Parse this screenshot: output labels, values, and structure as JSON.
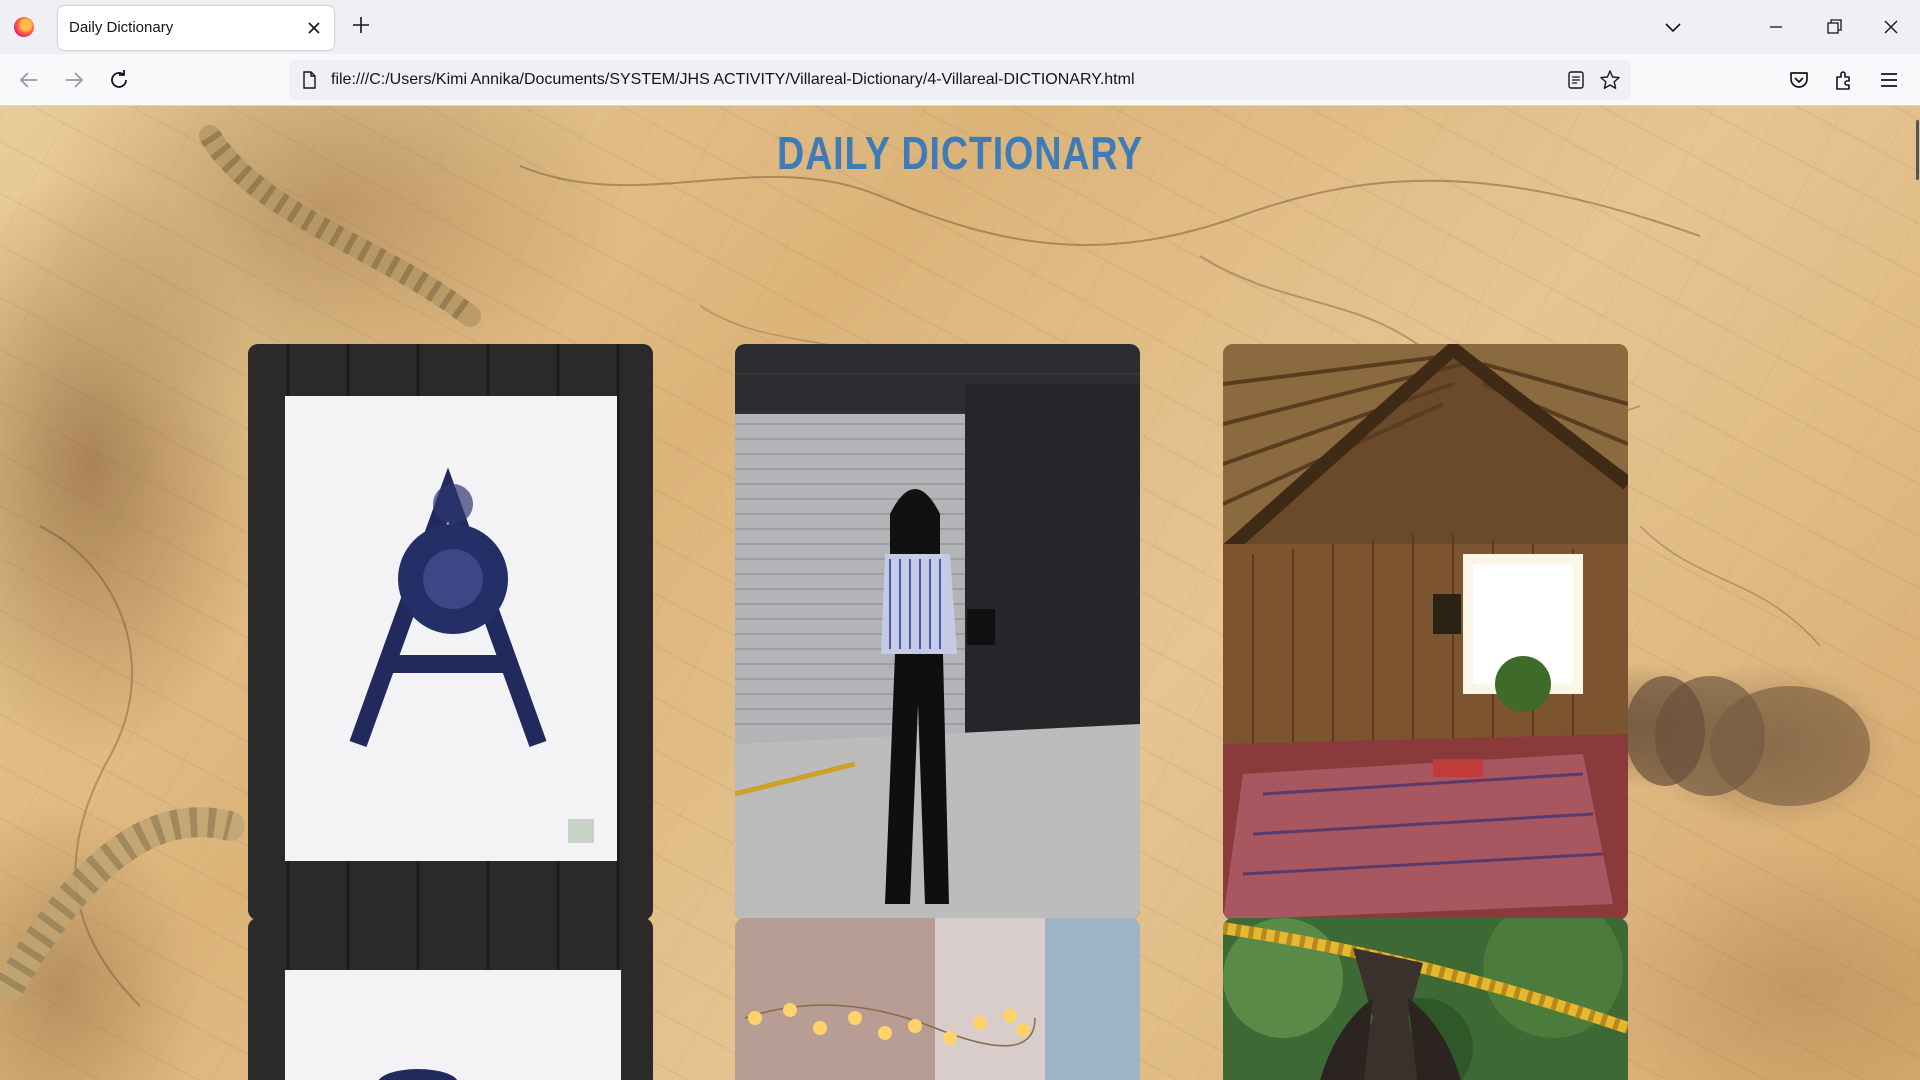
{
  "browser": {
    "tab_title": "Daily Dictionary",
    "url": "file:///C:/Users/Kimi Annika/Documents/SYSTEM/JHS ACTIVITY/Villareal-Dictionary/4-Villareal-DICTIONARY.html",
    "icons": [
      "firefox-logo",
      "close-icon",
      "plus-icon",
      "chevron-down-icon",
      "minimize-icon",
      "restore-icon",
      "close-icon",
      "back-arrow-icon",
      "forward-arrow-icon",
      "reload-icon",
      "page-icon",
      "reader-view-icon",
      "star-icon",
      "pocket-icon",
      "extensions-icon",
      "menu-icon"
    ]
  },
  "page": {
    "title": "DAILY DICTIONARY",
    "title_color": "#3f7bb5",
    "cards": [
      {
        "subject": "letter-a-flower-print"
      },
      {
        "subject": "woman-striped-shirt"
      },
      {
        "subject": "wooden-attic-room"
      },
      {
        "subject": "second-ink-print"
      },
      {
        "subject": "fairy-lights-room"
      },
      {
        "subject": "bat-on-rope"
      }
    ]
  }
}
